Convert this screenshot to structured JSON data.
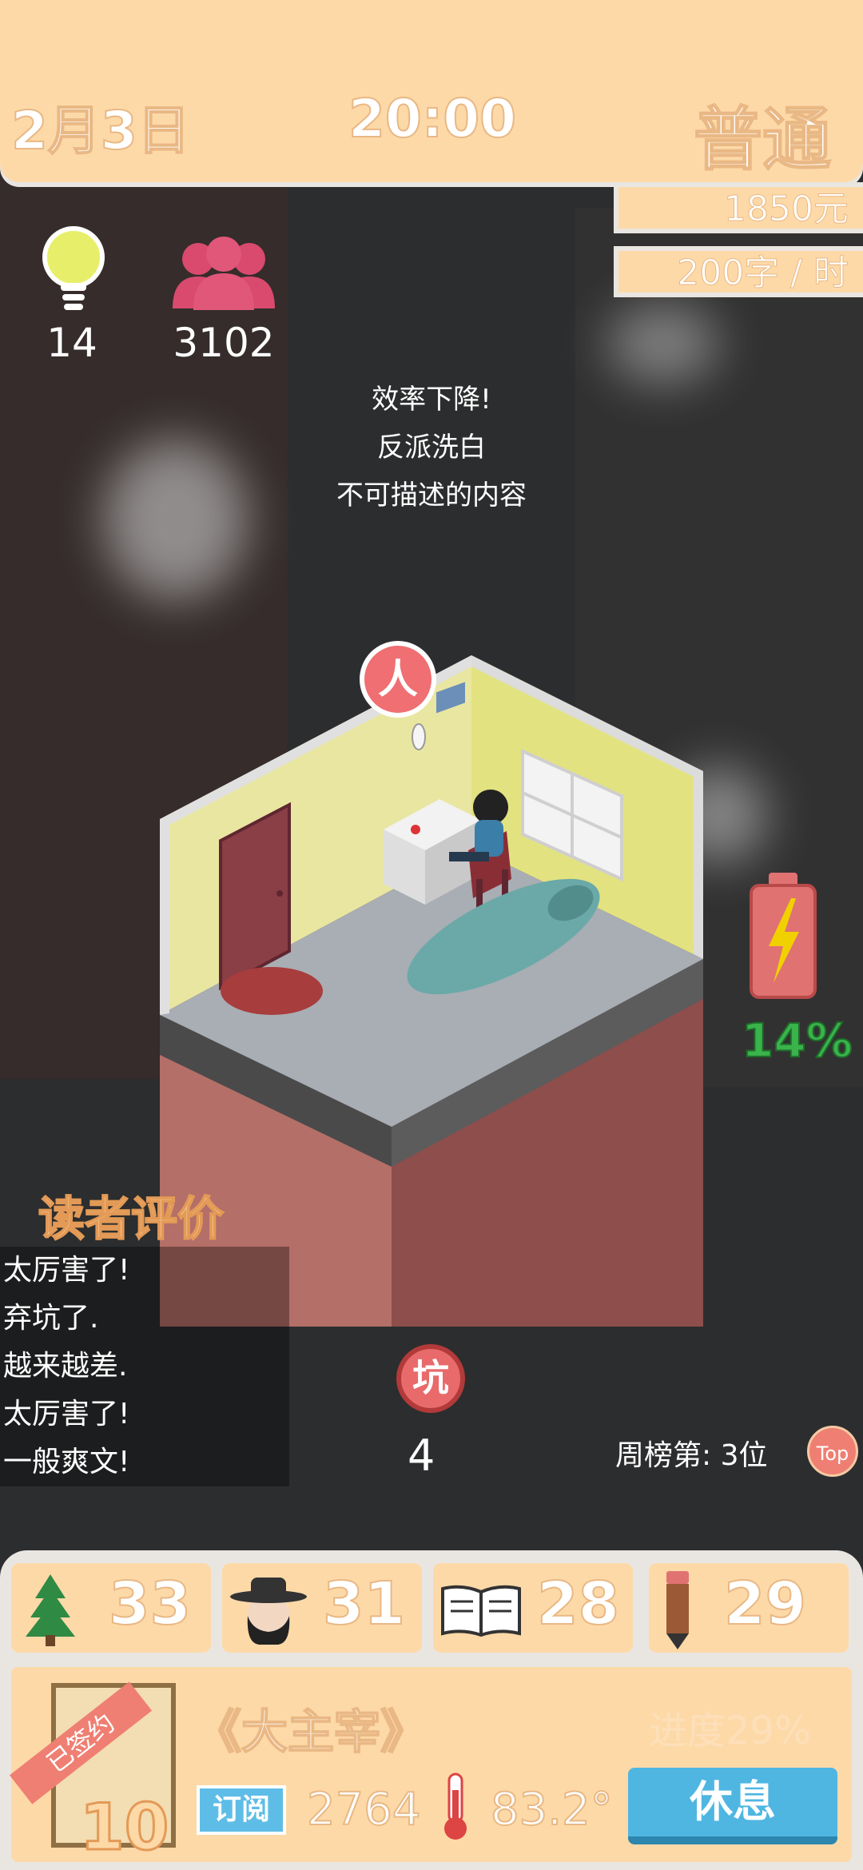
{
  "header": {
    "date": "2月3日",
    "time": "20:00",
    "mode": "普通",
    "money": "1850元",
    "speed": "200字 / 时"
  },
  "stats": {
    "ideas": "14",
    "fans": "3102"
  },
  "notices": [
    "效率下降!",
    "反派洗白",
    "不可描述的内容"
  ],
  "room": {
    "character_badge": "人"
  },
  "battery": {
    "percent_text": "14%",
    "level": 0.14,
    "color": "#39b34a"
  },
  "reviews": {
    "title": "读者评价",
    "items": [
      "太厉害了!",
      "弃坑了.",
      "越来越差.",
      "太厉害了!",
      "一般爽文!"
    ]
  },
  "pit": {
    "label": "坑",
    "count": "4"
  },
  "ranking": {
    "text": "周榜第: 3位",
    "top_label": "Top"
  },
  "attributes": [
    {
      "icon": "tree-icon",
      "value": "33"
    },
    {
      "icon": "hat-person-icon",
      "value": "31"
    },
    {
      "icon": "open-book-icon",
      "value": "28"
    },
    {
      "icon": "pencil-icon",
      "value": "29"
    }
  ],
  "book": {
    "signed_label": "已签约",
    "level": "10",
    "title": "《大主宰》",
    "progress": "进度29%",
    "subscribe_label": "订阅",
    "subscribers": "2764",
    "temperature": "83.2°",
    "rest_button": "休息"
  },
  "colors": {
    "panel": "#fdd9a8",
    "panel_border": "#e9e6e2",
    "accent_red": "#ef7f72",
    "button_blue": "#4fb6e2"
  }
}
